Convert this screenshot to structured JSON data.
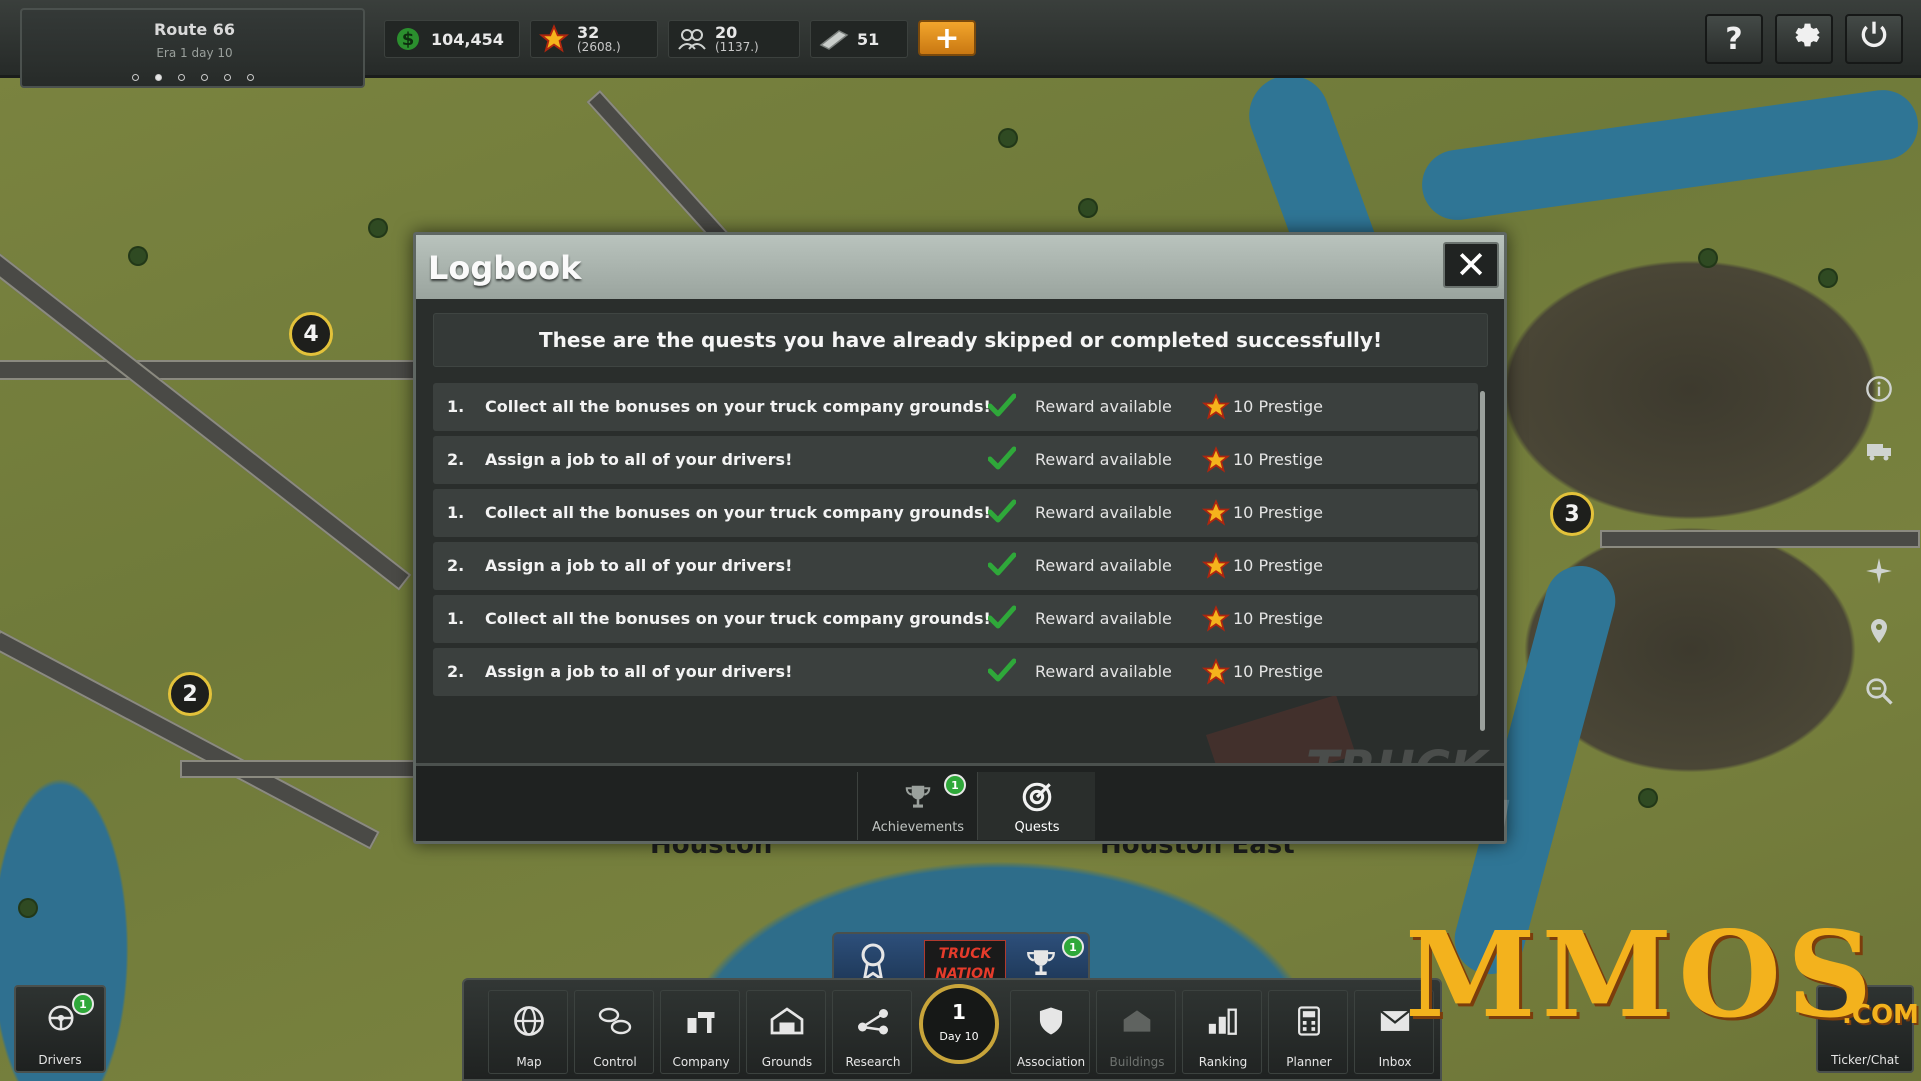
{
  "game": {
    "title": "Truck Nation"
  },
  "topbar": {
    "route_name": "Route 66",
    "era": "Era 1 day 10",
    "route_dots": 6,
    "route_dot_active": 1,
    "money": "104,454",
    "prestige": "32",
    "prestige_sub": "(2608.)",
    "population": "20",
    "population_sub": "(1137.)",
    "fuel": "51",
    "add_label": "+",
    "help_label": "?",
    "settings_icon": "gear-icon",
    "power_icon": "power-icon"
  },
  "map": {
    "markers": [
      "4",
      "3",
      "2"
    ],
    "city_labels": [
      "Houston",
      "Houston East"
    ]
  },
  "logbook": {
    "title": "Logbook",
    "close_label": "✕",
    "banner": "These are the quests you have already skipped or completed successfully!",
    "quests": [
      {
        "num": "1.",
        "text": "Collect all the bonuses on your truck company grounds!",
        "status": "Reward available",
        "reward": "10 Prestige"
      },
      {
        "num": "2.",
        "text": "Assign a job to all of your drivers!",
        "status": "Reward available",
        "reward": "10 Prestige"
      },
      {
        "num": "1.",
        "text": "Collect all the bonuses on your truck company grounds!",
        "status": "Reward available",
        "reward": "10 Prestige"
      },
      {
        "num": "2.",
        "text": "Assign a job to all of your drivers!",
        "status": "Reward available",
        "reward": "10 Prestige"
      },
      {
        "num": "1.",
        "text": "Collect all the bonuses on your truck company grounds!",
        "status": "Reward available",
        "reward": "10 Prestige"
      },
      {
        "num": "2.",
        "text": "Assign a job to all of your drivers!",
        "status": "Reward available",
        "reward": "10 Prestige"
      }
    ],
    "tabs": [
      {
        "label": "Achievements",
        "badge": "1",
        "active": false
      },
      {
        "label": "Quests",
        "badge": "",
        "active": true
      }
    ]
  },
  "bottombar": {
    "drivers": {
      "label": "Drivers",
      "badge": "1"
    },
    "buttons": [
      "Map",
      "Control",
      "Company",
      "Grounds",
      "Research",
      "Association",
      "Buildings",
      "Ranking",
      "Planner",
      "Inbox"
    ],
    "day_num": "1",
    "day_label": "Day 10",
    "hub_badge": "1",
    "hub_logo": "TRUCK NATION",
    "chat_label": "Ticker/Chat"
  },
  "watermark": {
    "brand": "MMOS",
    "suffix": ".COM"
  },
  "colors": {
    "accent_gold": "#e3c23a",
    "check_green": "#2fa83a",
    "button_orange": "#f2a52c"
  }
}
